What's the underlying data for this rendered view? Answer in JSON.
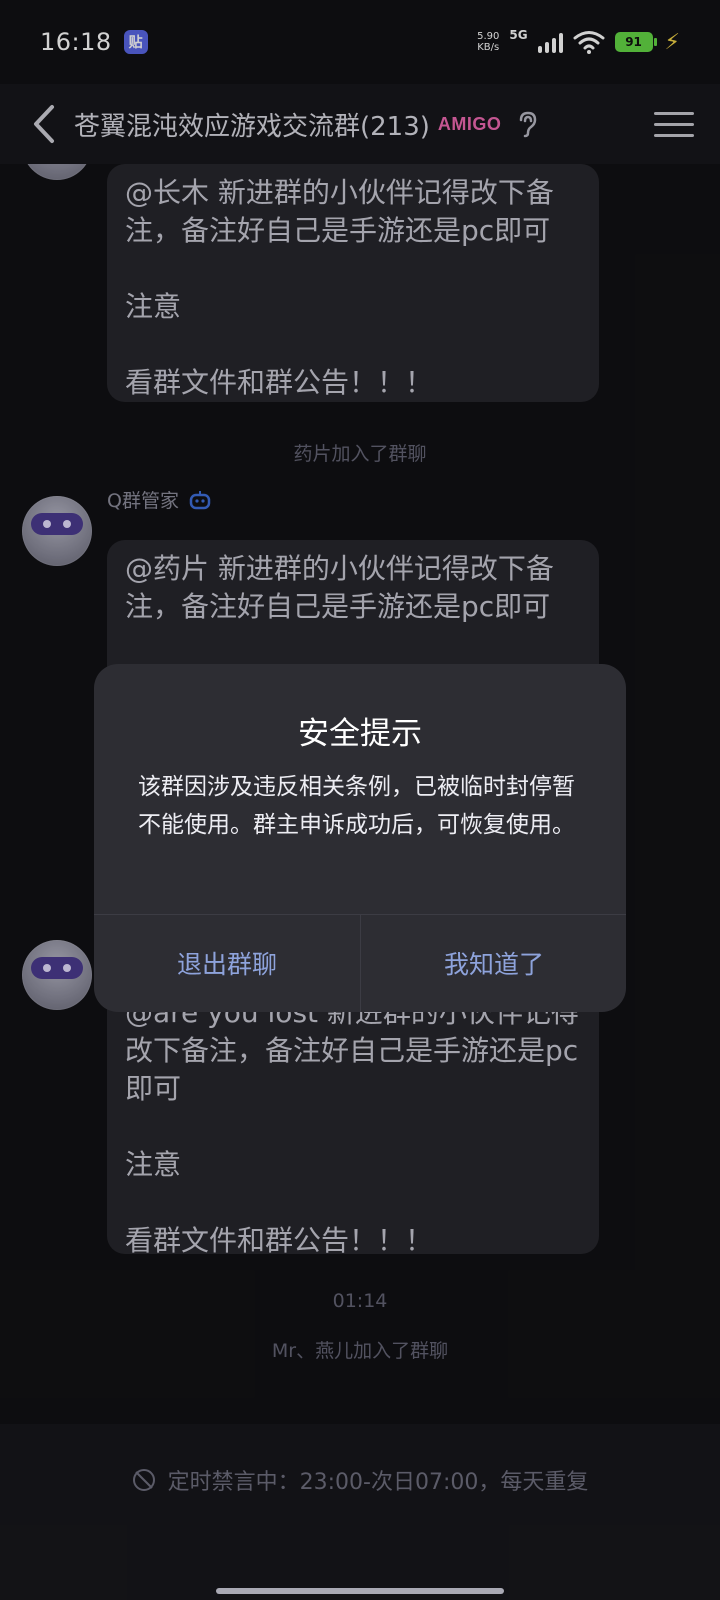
{
  "status_bar": {
    "time": "16:18",
    "sticker": "贴",
    "net_speed_top": "5.90",
    "net_speed_bottom": "KB/s",
    "network": "5G",
    "battery": "91"
  },
  "header": {
    "title": "苍翼混沌效应游戏交流群(213)",
    "badge": "AMIGO"
  },
  "chat": {
    "messages": [
      {
        "text": "@长木 新进群的小伙伴记得改下备注，备注好自己是手游还是pc即可\n\n注意\n\n看群文件和群公告！！！"
      },
      {
        "system": "药片加入了群聊"
      },
      {
        "sender": "Q群管家",
        "text": "@药片 新进群的小伙伴记得改下备注，备注好自己是手游还是pc即可"
      },
      {
        "text": "@are you lost 新进群的小伙伴记得改下备注，备注好自己是手游还是pc即可\n\n注意\n\n看群文件和群公告！！！"
      },
      {
        "time": "01:14"
      },
      {
        "system": "Mr、燕儿加入了群聊"
      }
    ]
  },
  "dialog": {
    "title": "安全提示",
    "message": "该群因涉及违反相关条例，已被临时封停暂不能使用。群主申诉成功后，可恢复使用。",
    "left_button": "退出群聊",
    "right_button": "我知道了"
  },
  "footer": {
    "mute_notice": "定时禁言中：23:00-次日07:00，每天重复"
  },
  "colors": {
    "background": "#111114",
    "bubble": "#27272d",
    "dialog": "#2d2d33",
    "dialog_button": "#8ea3dc",
    "battery": "#64d846",
    "bot_icon": "#3f6fdc"
  }
}
